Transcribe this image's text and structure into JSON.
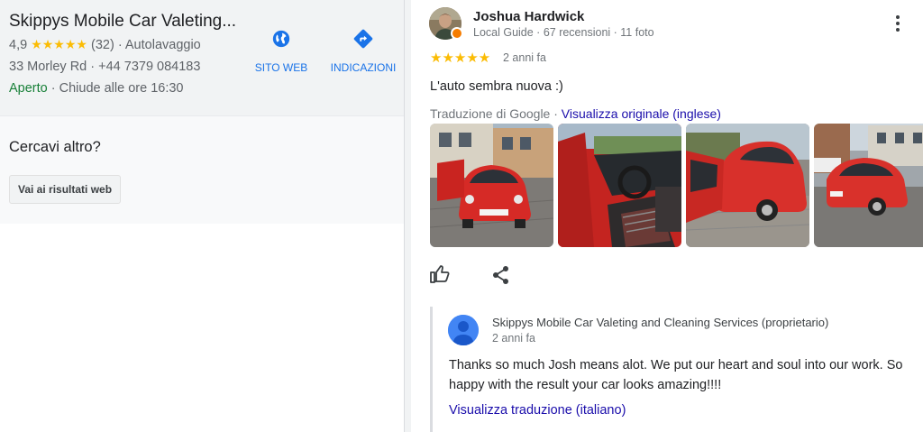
{
  "business": {
    "title": "Skippys Mobile Car Valeting...",
    "rating": "4,9",
    "stars": "★★★★★",
    "review_count": "(32)",
    "category": "Autolavaggio",
    "address": "33 Morley Rd",
    "phone": "+44 7379 084183",
    "status": "Aperto",
    "hours": "Chiude alle ore 16:30",
    "website_label": "SITO WEB",
    "directions_label": "INDICAZIONI"
  },
  "alternative": {
    "question": "Cercavi altro?",
    "button_label": "Vai ai risultati web"
  },
  "review": {
    "author": "Joshua Hardwick",
    "meta": "Local Guide · 67 recensioni · 11 foto",
    "stars": "★★★★★",
    "date": "2 anni fa",
    "text": "L'auto sembra nuova :)",
    "translation_prefix": "Traduzione di Google · ",
    "translation_link": "Visualizza originale (inglese)",
    "photos": [
      "car-front-photo",
      "car-interior-photo",
      "car-side-photo",
      "car-street-photo"
    ]
  },
  "owner_reply": {
    "author": "Skippys Mobile Car Valeting and Cleaning Services (proprietario)",
    "date": "2 anni fa",
    "text": "Thanks so much Josh means alot. We put our heart and soul into our work. So happy with the result your car looks amazing!!!!",
    "translate_link": "Visualizza traduzione (italiano)"
  },
  "colors": {
    "accent": "#1a73e8",
    "link": "#1a0dab",
    "star": "#fbbc04",
    "open": "#188038"
  }
}
